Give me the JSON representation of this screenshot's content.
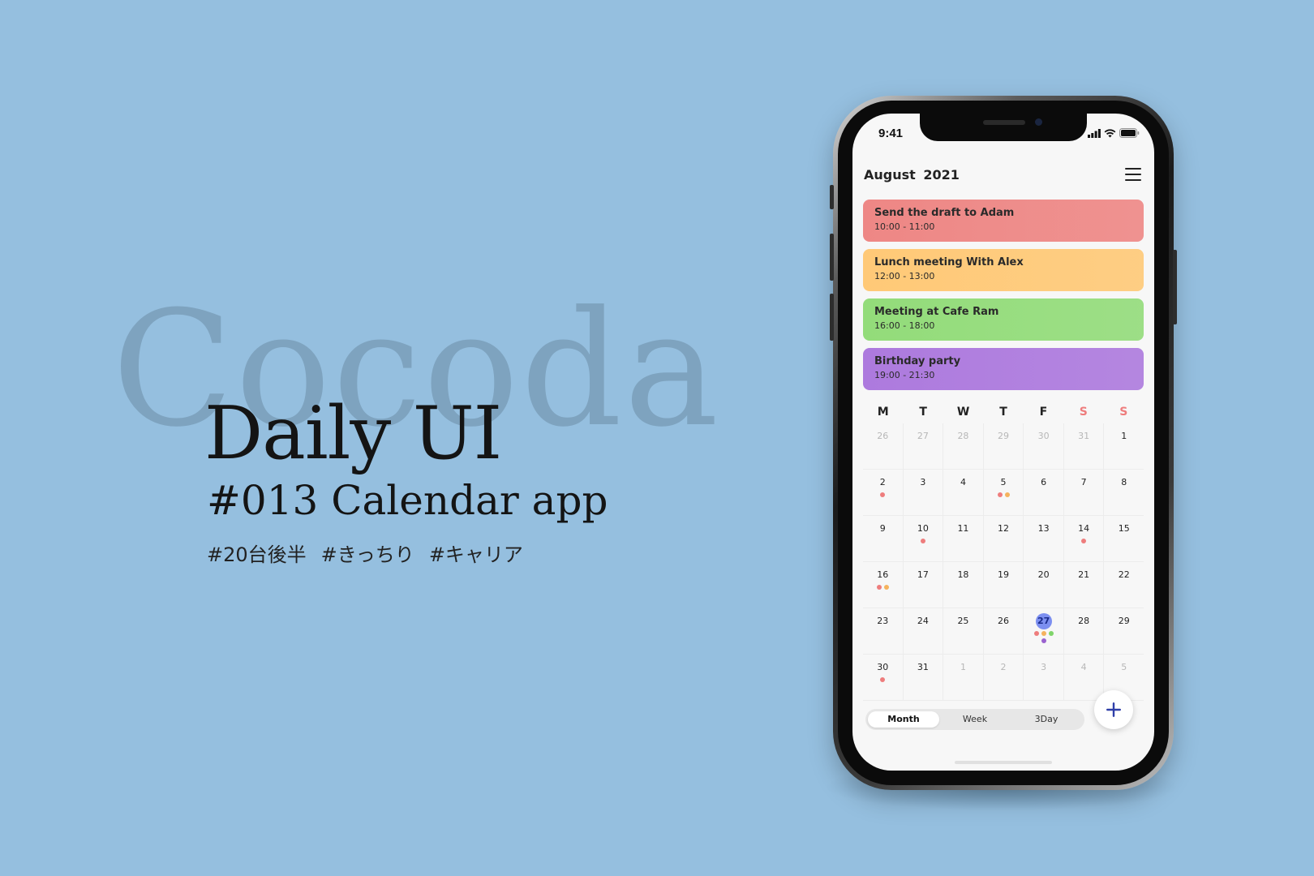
{
  "hero": {
    "watermark": "Cocoda",
    "title": "Daily UI",
    "subtitle": "#013 Calendar app",
    "tags": [
      "#20台後半",
      "#きっちり",
      "#キャリア"
    ]
  },
  "status_bar": {
    "time": "9:41"
  },
  "calendar": {
    "month_label": "August",
    "year_label": "2021",
    "events": [
      {
        "title": "Send the draft to Adam",
        "time": "10:00 - 11:00",
        "color": "#ee8785"
      },
      {
        "title": "Lunch meeting With Alex",
        "time": "12:00 - 13:00",
        "color": "#ffc977"
      },
      {
        "title": "Meeting at Cafe Ram",
        "time": "16:00 - 18:00",
        "color": "#93dc7a"
      },
      {
        "title": "Birthday party",
        "time": "19:00 - 21:30",
        "color": "#ad7ade"
      }
    ],
    "weekdays": [
      "M",
      "T",
      "W",
      "T",
      "F",
      "S",
      "S"
    ],
    "weekday_colors": [
      "#222222",
      "#222222",
      "#222222",
      "#222222",
      "#222222",
      "#ee7d7d",
      "#ee7d7d"
    ],
    "dot_colors": {
      "red": "#ee7d7d",
      "orange": "#f5b35e",
      "green": "#7fd46a",
      "purple": "#9a62cf"
    },
    "weeks": [
      [
        {
          "d": "26",
          "m": true
        },
        {
          "d": "27",
          "m": true
        },
        {
          "d": "28",
          "m": true
        },
        {
          "d": "29",
          "m": true
        },
        {
          "d": "30",
          "m": true
        },
        {
          "d": "31",
          "m": true
        },
        {
          "d": "1"
        }
      ],
      [
        {
          "d": "2",
          "dots": [
            "red"
          ]
        },
        {
          "d": "3"
        },
        {
          "d": "4"
        },
        {
          "d": "5",
          "dots": [
            "red",
            "orange"
          ]
        },
        {
          "d": "6"
        },
        {
          "d": "7"
        },
        {
          "d": "8"
        }
      ],
      [
        {
          "d": "9"
        },
        {
          "d": "10",
          "dots": [
            "red"
          ]
        },
        {
          "d": "11"
        },
        {
          "d": "12"
        },
        {
          "d": "13"
        },
        {
          "d": "14",
          "dots": [
            "red"
          ]
        },
        {
          "d": "15"
        }
      ],
      [
        {
          "d": "16",
          "dots": [
            "red",
            "orange"
          ]
        },
        {
          "d": "17"
        },
        {
          "d": "18"
        },
        {
          "d": "19"
        },
        {
          "d": "20"
        },
        {
          "d": "21"
        },
        {
          "d": "22"
        }
      ],
      [
        {
          "d": "23"
        },
        {
          "d": "24"
        },
        {
          "d": "25"
        },
        {
          "d": "26"
        },
        {
          "d": "27",
          "today": true,
          "dots": [
            "red",
            "orange",
            "green",
            "purple"
          ]
        },
        {
          "d": "28"
        },
        {
          "d": "29"
        }
      ],
      [
        {
          "d": "30",
          "dots": [
            "red"
          ]
        },
        {
          "d": "31"
        },
        {
          "d": "1",
          "m": true
        },
        {
          "d": "2",
          "m": true
        },
        {
          "d": "3",
          "m": true
        },
        {
          "d": "4",
          "m": true
        },
        {
          "d": "5",
          "m": true
        }
      ]
    ],
    "view_tabs": [
      {
        "label": "Month",
        "active": true
      },
      {
        "label": "Week",
        "active": false
      },
      {
        "label": "3Day",
        "active": false
      }
    ],
    "fab_icon": "plus-icon",
    "accent_color": "#2f3fa8"
  }
}
